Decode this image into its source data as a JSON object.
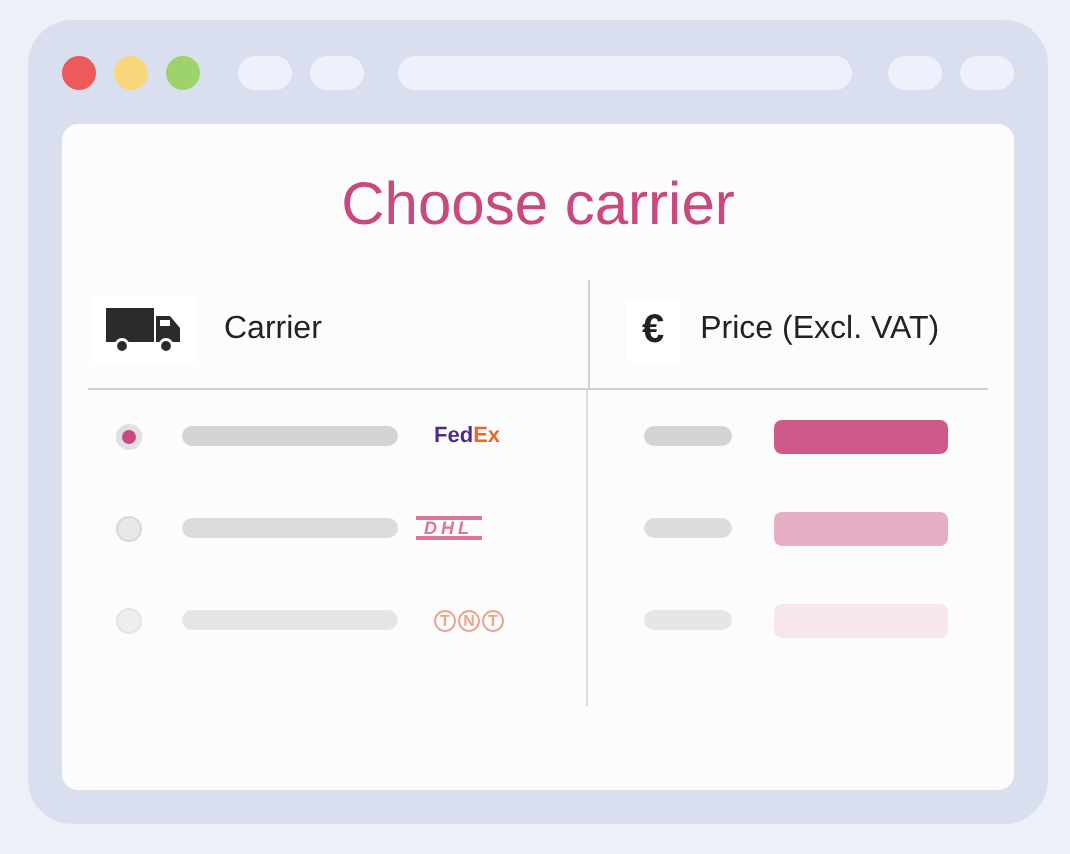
{
  "title": "Choose carrier",
  "columns": [
    {
      "kind": "carrier",
      "label": "Carrier"
    },
    {
      "kind": "price",
      "label": "Price (Excl. VAT)",
      "symbol": "€"
    }
  ],
  "rows": [
    {
      "selected": true,
      "kind": "fedex",
      "logo_parts": [
        "Fed",
        "Ex"
      ]
    },
    {
      "selected": false,
      "kind": "dhl",
      "logo_parts": [
        "DHL"
      ]
    },
    {
      "selected": false,
      "kind": "tnt",
      "logo_parts": [
        "T",
        "N",
        "T"
      ]
    }
  ]
}
